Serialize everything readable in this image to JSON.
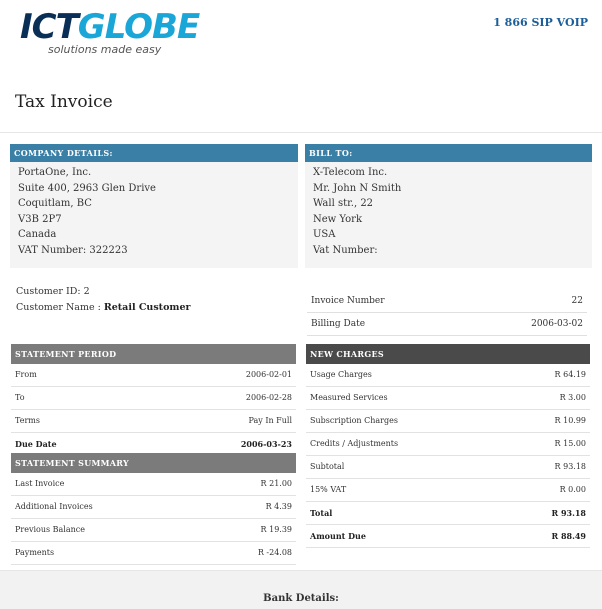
{
  "header": {
    "logo_word_a": "ICT",
    "logo_word_b": "GLOBE",
    "logo_tagline": "solutions made easy",
    "phone": "1 866 SIP VOIP"
  },
  "title": "Tax Invoice",
  "company": {
    "header": "COMPANY DETAILS:",
    "lines": [
      "PortaOne, Inc.",
      "Suite 400, 2963 Glen Drive",
      "Coquitlam, BC",
      "V3B 2P7",
      "Canada",
      "VAT Number: 322223"
    ]
  },
  "bill_to": {
    "header": "BILL TO:",
    "lines": [
      "X-Telecom Inc.",
      "Mr. John N Smith",
      "Wall str., 22",
      "New York",
      "USA",
      "Vat Number:"
    ]
  },
  "customer": {
    "id_label": "Customer ID:",
    "id_value": "2",
    "name_label": "Customer Name :",
    "name_value": "Retail Customer"
  },
  "invoice_info": [
    {
      "label": "Invoice Number",
      "value": "22"
    },
    {
      "label": "Billing Date",
      "value": "2006-03-02"
    }
  ],
  "statement_period": {
    "header": "STATEMENT PERIOD",
    "rows": [
      {
        "label": "From",
        "value": "2006-02-01"
      },
      {
        "label": "To",
        "value": "2006-02-28"
      },
      {
        "label": "Terms",
        "value": "Pay In Full"
      },
      {
        "label": "Due Date",
        "value": "2006-03-23"
      }
    ]
  },
  "statement_summary": {
    "header": "STATEMENT SUMMARY",
    "rows": [
      {
        "label": "Last Invoice",
        "value": "R 21.00"
      },
      {
        "label": "Additional Invoices",
        "value": "R 4.39"
      },
      {
        "label": "Previous Balance",
        "value": "R 19.39"
      },
      {
        "label": "Payments",
        "value": "R -24.08"
      }
    ]
  },
  "new_charges": {
    "header": "NEW CHARGES",
    "rows": [
      {
        "label": "Usage Charges",
        "value": "R 64.19"
      },
      {
        "label": "Measured Services",
        "value": "R 3.00"
      },
      {
        "label": "Subscription Charges",
        "value": "R 10.99"
      },
      {
        "label": "Credits / Adjustments",
        "value": "R 15.00"
      },
      {
        "label": "Subtotal",
        "value": "R 93.18"
      },
      {
        "label": "15% VAT",
        "value": "R 0.00"
      },
      {
        "label": "Total",
        "value": "R 93.18"
      },
      {
        "label": "Amount Due",
        "value": "R 88.49"
      }
    ]
  },
  "footer": {
    "bank_label": "Bank Details:"
  },
  "colors": {
    "accent_blue": "#3a7fa6",
    "header_gray": "#7b7b7b",
    "header_dark": "#4a4a4a",
    "logo_light": "#1aa7d8",
    "logo_dark": "#0a2f57"
  }
}
